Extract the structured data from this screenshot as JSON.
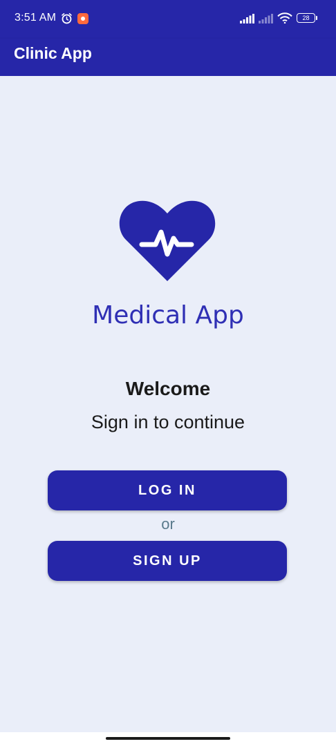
{
  "status_bar": {
    "time": "3:51 AM",
    "battery_level": "28",
    "icons": [
      "alarm-icon",
      "screen-record-icon",
      "signal-icon",
      "signal-icon",
      "wifi-icon",
      "battery-icon"
    ]
  },
  "app_bar": {
    "title": "Clinic App"
  },
  "main": {
    "logo_icon": "heart-pulse-icon",
    "app_name": "Medical App",
    "welcome": "Welcome",
    "subtitle": "Sign in to continue",
    "login_label": "LOG IN",
    "or_label": "or",
    "signup_label": "SIGN UP"
  },
  "colors": {
    "primary": "#2626a8",
    "background": "#eaeef9",
    "accent_text": "#2f2fb4",
    "or_text": "#5a7a8c"
  }
}
